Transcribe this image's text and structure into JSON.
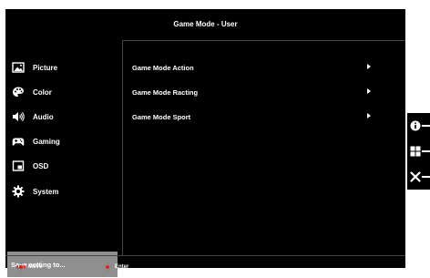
{
  "title": "Game Mode - User",
  "sidebar": {
    "items": [
      {
        "label": "Picture",
        "icon": "picture-icon"
      },
      {
        "label": "Color",
        "icon": "palette-icon"
      },
      {
        "label": "Audio",
        "icon": "speaker-icon"
      },
      {
        "label": "Gaming",
        "icon": "gamepad-icon"
      },
      {
        "label": "OSD",
        "icon": "osd-window-icon"
      },
      {
        "label": "System",
        "icon": "gear-icon"
      }
    ],
    "save_label": "Save setting to..."
  },
  "menu": {
    "items": [
      {
        "label": "Game Mode Action"
      },
      {
        "label": "Game Mode Racting"
      },
      {
        "label": "Game Mode Sport"
      }
    ]
  },
  "footer": {
    "move_label": "Move",
    "enter_label": "Enter"
  },
  "side_keys": [
    "info-icon",
    "input-grid-icon",
    "close-icon"
  ],
  "colors": {
    "background": "#000000",
    "text": "#ffffff",
    "save_highlight": "#8f8f8f",
    "divider": "#444444",
    "nav_accent": "#e02020"
  }
}
